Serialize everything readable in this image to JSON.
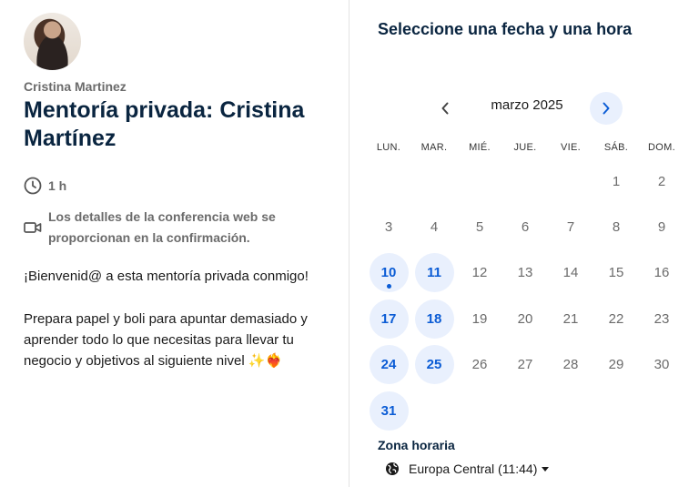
{
  "event": {
    "organizer": "Cristina Martinez",
    "title": "Mentoría privada: Cristina Martínez",
    "duration": "1 h",
    "conference_note": "Los detalles de la conferencia web se proporcionan en la confirmación.",
    "description_1": "¡Bienvenid@ a esta mentoría privada conmigo!",
    "description_2": "Prepara papel y boli para apuntar demasiado y aprender todo lo que necesitas para llevar tu negocio y objetivos al siguiente nivel ✨❤️‍🔥"
  },
  "schedule": {
    "title": "Seleccione una fecha y una hora",
    "month_label": "marzo 2025",
    "weekdays": [
      "LUN.",
      "MAR.",
      "MIÉ.",
      "JUE.",
      "VIE.",
      "SÁB.",
      "DOM."
    ],
    "leading_blanks": 5,
    "days": [
      {
        "n": "1"
      },
      {
        "n": "2"
      },
      {
        "n": "3"
      },
      {
        "n": "4"
      },
      {
        "n": "5"
      },
      {
        "n": "6"
      },
      {
        "n": "7"
      },
      {
        "n": "8"
      },
      {
        "n": "9"
      },
      {
        "n": "10",
        "available": true,
        "today": true
      },
      {
        "n": "11",
        "available": true
      },
      {
        "n": "12"
      },
      {
        "n": "13"
      },
      {
        "n": "14"
      },
      {
        "n": "15"
      },
      {
        "n": "16"
      },
      {
        "n": "17",
        "available": true
      },
      {
        "n": "18",
        "available": true
      },
      {
        "n": "19"
      },
      {
        "n": "20"
      },
      {
        "n": "21"
      },
      {
        "n": "22"
      },
      {
        "n": "23"
      },
      {
        "n": "24",
        "available": true
      },
      {
        "n": "25",
        "available": true
      },
      {
        "n": "26"
      },
      {
        "n": "27"
      },
      {
        "n": "28"
      },
      {
        "n": "29"
      },
      {
        "n": "30"
      },
      {
        "n": "31",
        "available": true
      }
    ],
    "timezone_label": "Zona horaria",
    "timezone_value": "Europa Central (11:44)"
  },
  "icons": {
    "duration": "clock-icon",
    "conference": "video-camera-icon",
    "timezone": "globe-icon",
    "prev": "chevron-left-icon",
    "next": "chevron-right-icon"
  },
  "colors": {
    "accent": "#0b5cd5",
    "accent_bg": "#e9f0fd",
    "heading": "#0a2540",
    "muted": "#6b6b6b"
  }
}
